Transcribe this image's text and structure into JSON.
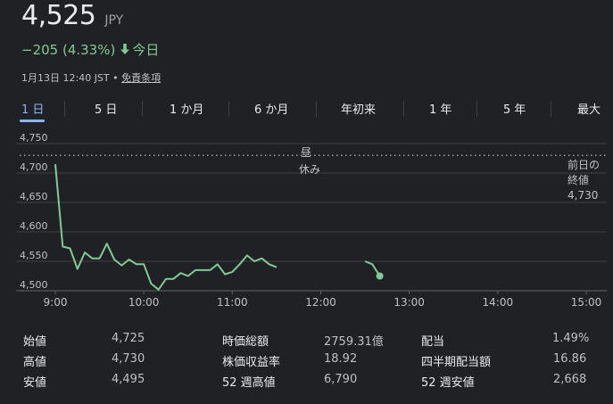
{
  "header": {
    "price": "4,525",
    "currency": "JPY",
    "change": "−205 (4.33%)",
    "change_period": "今日",
    "timestamp": "1月13日 12:40 JST",
    "separator": "•",
    "disclaimer": "免責条項",
    "arrow_icon": "arrow-down-icon",
    "change_color": "#81c995"
  },
  "tabs": [
    {
      "label": "1 日",
      "active": true
    },
    {
      "label": "5 日",
      "active": false
    },
    {
      "label": "1 か月",
      "active": false
    },
    {
      "label": "6 か月",
      "active": false
    },
    {
      "label": "年初来",
      "active": false
    },
    {
      "label": "1 年",
      "active": false
    },
    {
      "label": "5 年",
      "active": false
    },
    {
      "label": "最大",
      "active": false
    }
  ],
  "chart_data": {
    "type": "line",
    "y_ticks": [
      "4,750",
      "4,700",
      "4,650",
      "4,600",
      "4,550",
      "4,500"
    ],
    "x_ticks": [
      "9:00",
      "10:00",
      "11:00",
      "12:00",
      "13:00",
      "14:00",
      "15:00"
    ],
    "ylim": [
      4500,
      4750
    ],
    "xlim": [
      "9:00",
      "15:00"
    ],
    "lunch_label": [
      "昼",
      "休み"
    ],
    "prev_close_label": [
      "前日の",
      "終値",
      "4,730"
    ],
    "prev_close": 4730,
    "line_color": "#81c995",
    "morning_series": [
      {
        "t": "9:00",
        "v": 4715
      },
      {
        "t": "9:05",
        "v": 4575
      },
      {
        "t": "9:10",
        "v": 4572
      },
      {
        "t": "9:15",
        "v": 4537
      },
      {
        "t": "9:20",
        "v": 4565
      },
      {
        "t": "9:25",
        "v": 4555
      },
      {
        "t": "9:30",
        "v": 4555
      },
      {
        "t": "9:35",
        "v": 4580
      },
      {
        "t": "9:40",
        "v": 4553
      },
      {
        "t": "9:45",
        "v": 4543
      },
      {
        "t": "9:50",
        "v": 4553
      },
      {
        "t": "9:55",
        "v": 4545
      },
      {
        "t": "10:00",
        "v": 4545
      },
      {
        "t": "10:05",
        "v": 4512
      },
      {
        "t": "10:10",
        "v": 4502
      },
      {
        "t": "10:15",
        "v": 4520
      },
      {
        "t": "10:20",
        "v": 4520
      },
      {
        "t": "10:25",
        "v": 4530
      },
      {
        "t": "10:30",
        "v": 4525
      },
      {
        "t": "10:35",
        "v": 4535
      },
      {
        "t": "10:40",
        "v": 4535
      },
      {
        "t": "10:45",
        "v": 4535
      },
      {
        "t": "10:50",
        "v": 4545
      },
      {
        "t": "10:55",
        "v": 4528
      },
      {
        "t": "11:00",
        "v": 4532
      },
      {
        "t": "11:05",
        "v": 4545
      },
      {
        "t": "11:10",
        "v": 4560
      },
      {
        "t": "11:15",
        "v": 4550
      },
      {
        "t": "11:20",
        "v": 4555
      },
      {
        "t": "11:25",
        "v": 4545
      },
      {
        "t": "11:30",
        "v": 4540
      }
    ],
    "afternoon_series": [
      {
        "t": "12:30",
        "v": 4550
      },
      {
        "t": "12:35",
        "v": 4545
      },
      {
        "t": "12:40",
        "v": 4525
      }
    ]
  },
  "stats": [
    [
      {
        "label": "始値",
        "value": "4,725"
      },
      {
        "label": "時価総額",
        "value": "2759.31億"
      },
      {
        "label": "配当",
        "value": "1.49%"
      }
    ],
    [
      {
        "label": "高値",
        "value": "4,730"
      },
      {
        "label": "株価収益率",
        "value": "18.92"
      },
      {
        "label": "四半期配当額",
        "value": "16.86"
      }
    ],
    [
      {
        "label": "安値",
        "value": "4,495"
      },
      {
        "label": "52 週高値",
        "value": "6,790"
      },
      {
        "label": "52 週安値",
        "value": "2,668"
      }
    ]
  ]
}
